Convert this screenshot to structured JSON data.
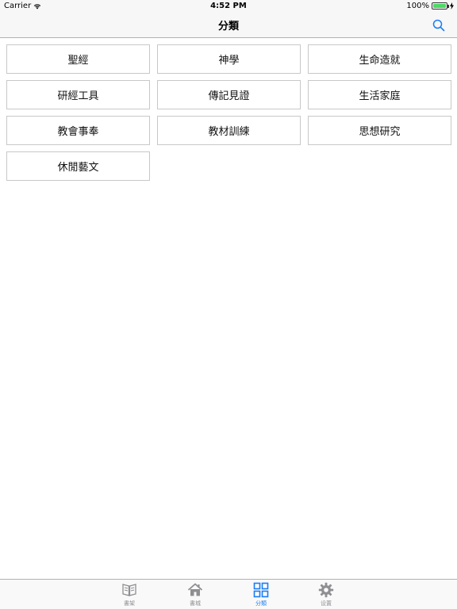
{
  "status_bar": {
    "carrier": "Carrier",
    "time": "4:52 PM",
    "battery": "100%"
  },
  "nav": {
    "title": "分類"
  },
  "categories": [
    "聖經",
    "神學",
    "生命造就",
    "研經工具",
    "傳記見證",
    "生活家庭",
    "教會事奉",
    "教材訓練",
    "思想研究",
    "休閒藝文"
  ],
  "tabs": [
    {
      "label": "書架",
      "icon": "bookshelf-icon",
      "active": false
    },
    {
      "label": "書城",
      "icon": "home-icon",
      "active": false
    },
    {
      "label": "分類",
      "icon": "grid-icon",
      "active": true
    },
    {
      "label": "设置",
      "icon": "gear-icon",
      "active": false
    }
  ],
  "colors": {
    "accent": "#1a7cf5",
    "inactive": "#8e8e93",
    "battery": "#4cd964"
  }
}
